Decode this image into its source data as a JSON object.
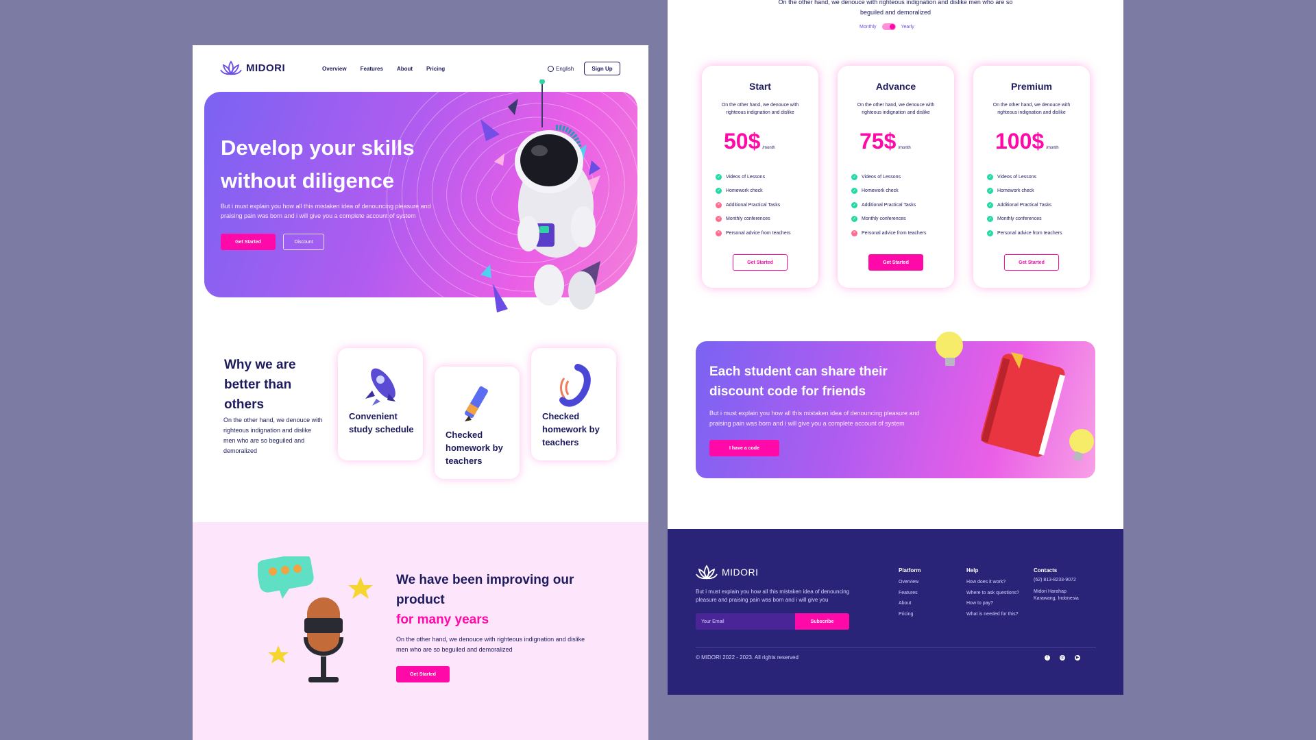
{
  "brand": {
    "name": "MIDORI"
  },
  "nav": {
    "links": [
      "Overview",
      "Features",
      "About",
      "Pricing"
    ],
    "language": "English",
    "signup_label": "Sign Up"
  },
  "hero": {
    "title": "Develop your skills without diligence",
    "description": "But i must explain you how all this mistaken idea of denouncing pleasure and praising pain was born and i will give you a complete account of system",
    "primary_button": "Get Started",
    "secondary_button": "Discount"
  },
  "why": {
    "title": "Why we are better than others",
    "description": "On the other hand, we denouce with righteous indignation and dislike men who are so beguiled and demoralized",
    "features": [
      {
        "label": "Convenient study schedule",
        "icon": "rocket-icon"
      },
      {
        "label": "Checked homework by teachers",
        "icon": "pencil-icon"
      },
      {
        "label": "Checked homework by teachers",
        "icon": "phone-icon"
      }
    ]
  },
  "improve": {
    "title_line": "We have been improving our product",
    "title_highlight": "for many years",
    "description": "On the other hand, we denouce with righteous indignation and dislike men who are so beguiled and demoralized",
    "button": "Get Started"
  },
  "pricing": {
    "top_description": "On the other hand, we denouce with righteous indignation and dislike men who are so beguiled and demoralized",
    "toggle": {
      "left": "Monthly",
      "right": "Yearly",
      "selected": "Yearly"
    },
    "plans": [
      {
        "name": "Start",
        "description": "On the other hand, we denouce with righteous indignation and dislike",
        "price": "50$",
        "period": "/month",
        "features": [
          {
            "text": "Videos of Lessons",
            "included": true
          },
          {
            "text": "Homework check",
            "included": true
          },
          {
            "text": "Additional Practical Tasks",
            "included": false
          },
          {
            "text": "Monthly conferences",
            "included": false
          },
          {
            "text": "Personal advice from teachers",
            "included": false
          }
        ],
        "button": "Get Started",
        "highlight": false
      },
      {
        "name": "Advance",
        "description": "On the other hand, we denouce with righteous indignation and dislike",
        "price": "75$",
        "period": "/month",
        "features": [
          {
            "text": "Videos of Lessons",
            "included": true
          },
          {
            "text": "Homework check",
            "included": true
          },
          {
            "text": "Additional Practical Tasks",
            "included": true
          },
          {
            "text": "Monthly conferences",
            "included": true
          },
          {
            "text": "Personal advice from teachers",
            "included": false
          }
        ],
        "button": "Get Started",
        "highlight": true
      },
      {
        "name": "Premium",
        "description": "On the other hand, we denouce with righteous indignation and dislike",
        "price": "100$",
        "period": "/month",
        "features": [
          {
            "text": "Videos of Lessons",
            "included": true
          },
          {
            "text": "Homework check",
            "included": true
          },
          {
            "text": "Additional Practical Tasks",
            "included": true
          },
          {
            "text": "Monthly conferences",
            "included": true
          },
          {
            "text": "Personal advice from teachers",
            "included": true
          }
        ],
        "button": "Get Started",
        "highlight": false
      }
    ]
  },
  "discount": {
    "title": "Each student can share their discount code for friends",
    "description": "But i must explain you how all this mistaken idea of denouncing pleasure and praising pain was born and i will give you a complete account of system",
    "button": "I have a code"
  },
  "footer": {
    "description": "But i must explain you how all this mistaken idea of denouncing pleasure and praising pain was born and i will give you",
    "email_placeholder": "Your Email",
    "subscribe": "Subscribe",
    "columns": [
      {
        "title": "Platform",
        "items": [
          "Overview",
          "Features",
          "About",
          "Pricing"
        ]
      },
      {
        "title": "Help",
        "items": [
          "How does it work?",
          "Where to ask questions?",
          "How to pay?",
          "What is needed for this?"
        ]
      }
    ],
    "contacts": {
      "title": "Contacts",
      "phone": "(62) 813-8233-9072",
      "address_line1": "Midori Harahap",
      "address_line2": "Karawang, Indonesia"
    },
    "copyright": "© MIDORI 2022 - 2023. All rights reserved",
    "social": [
      "facebook-icon",
      "instagram-icon",
      "youtube-icon"
    ]
  },
  "colors": {
    "background": "#7b7ba3",
    "brand_navy": "#1d1b5e",
    "accent_pink": "#ff0aa9",
    "footer_bg": "#292478",
    "check_green": "#25d9a5",
    "cross_red": "#ff6b8f"
  }
}
